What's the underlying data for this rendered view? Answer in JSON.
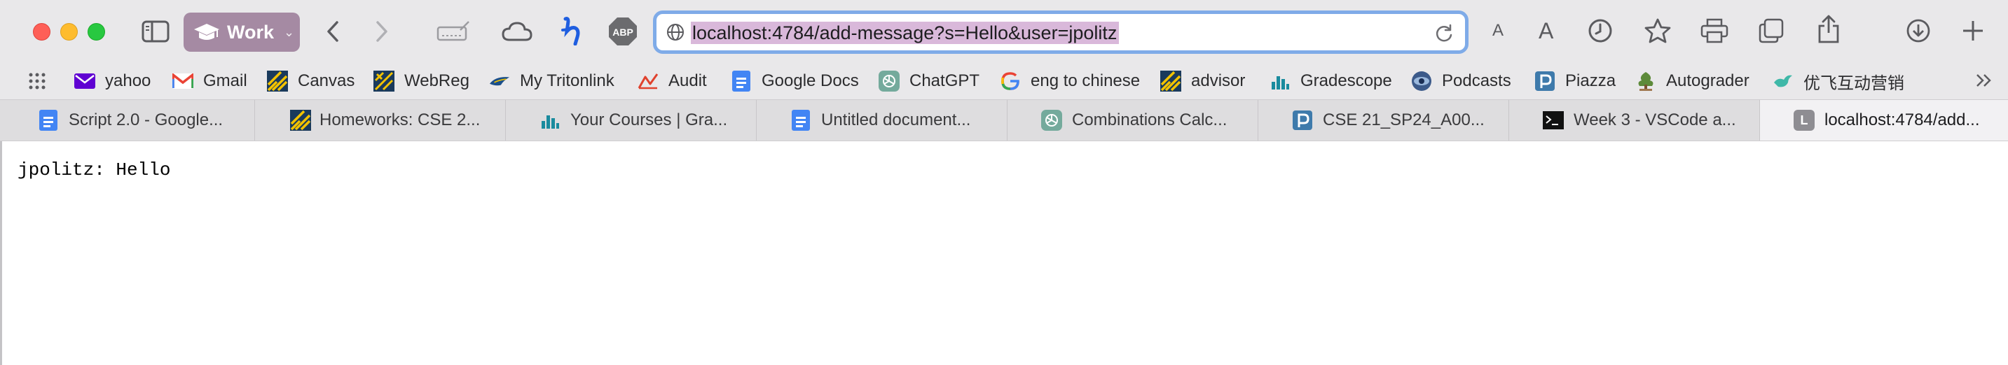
{
  "toolbar": {
    "profile_label": "Work",
    "url": "localhost:4784/add-message?s=Hello&user=jpolitz",
    "font_small": "A",
    "font_large": "A",
    "adblock_label": "ABP"
  },
  "bookmarks": [
    {
      "label": "yahoo",
      "icon": "yahoo-mail-icon"
    },
    {
      "label": "Gmail",
      "icon": "gmail-icon"
    },
    {
      "label": "Canvas",
      "icon": "canvas-icon"
    },
    {
      "label": "WebReg",
      "icon": "webreg-icon"
    },
    {
      "label": "My Tritonlink",
      "icon": "tritonlink-icon"
    },
    {
      "label": "Audit",
      "icon": "audit-icon"
    },
    {
      "label": "Google Docs",
      "icon": "google-docs-icon"
    },
    {
      "label": "ChatGPT",
      "icon": "chatgpt-icon"
    },
    {
      "label": "eng to chinese",
      "icon": "google-icon"
    },
    {
      "label": "advisor",
      "icon": "advisor-icon"
    },
    {
      "label": "Gradescope",
      "icon": "gradescope-icon"
    },
    {
      "label": "Podcasts",
      "icon": "podcasts-icon"
    },
    {
      "label": "Piazza",
      "icon": "piazza-icon"
    },
    {
      "label": "Autograder",
      "icon": "autograder-icon"
    },
    {
      "label": "优飞互动营销",
      "icon": "bird-icon"
    }
  ],
  "tabs": [
    {
      "label": "Script 2.0 - Google...",
      "icon": "google-docs-icon"
    },
    {
      "label": "Homeworks: CSE 2...",
      "icon": "canvas-icon"
    },
    {
      "label": "Your Courses | Gra...",
      "icon": "gradescope-icon"
    },
    {
      "label": "Untitled document...",
      "icon": "google-docs-icon"
    },
    {
      "label": "Combinations Calc...",
      "icon": "chatgpt-icon"
    },
    {
      "label": "CSE 21_SP24_A00...",
      "icon": "piazza-icon"
    },
    {
      "label": "Week 3 - VSCode a...",
      "icon": "terminal-icon"
    },
    {
      "label": "localhost:4784/add...",
      "icon": "letter-l-icon",
      "active": true
    }
  ],
  "tab_letter": "L",
  "page": {
    "message": "jpolitz: Hello"
  },
  "colors": {
    "toolbar_bg": "#e9e8ea",
    "profile_bg": "#a58aa3",
    "url_focus_ring": "#7fabe8",
    "url_selection": "#d9b8da"
  }
}
